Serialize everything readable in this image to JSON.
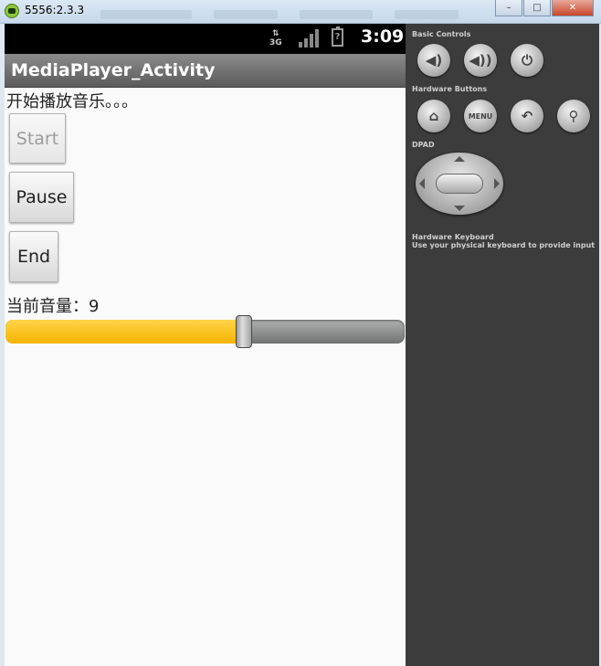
{
  "window": {
    "title": "5556:2.3.3",
    "controls": {
      "minimize": "–",
      "maximize": "□",
      "close": "✕"
    }
  },
  "statusbar": {
    "network": "3G",
    "battery_glyph": "?",
    "time": "3:09"
  },
  "app": {
    "title": "MediaPlayer_Activity",
    "status_text": "开始播放音乐。。。",
    "buttons": {
      "start": "Start",
      "pause": "Pause",
      "end": "End"
    },
    "volume_label": "当前音量：9",
    "volume_fraction": 0.597
  },
  "panel": {
    "basic_controls": "Basic Controls",
    "hardware_buttons": "Hardware Buttons",
    "menu_label": "MENU",
    "dpad": "DPAD",
    "hardware_keyboard": "Hardware Keyboard",
    "keyboard_hint": "Use your physical keyboard to provide input"
  },
  "colors": {
    "accent": "#f5b400",
    "appbar": "#6f6f6f",
    "panel_bg": "#3c3c3c"
  }
}
